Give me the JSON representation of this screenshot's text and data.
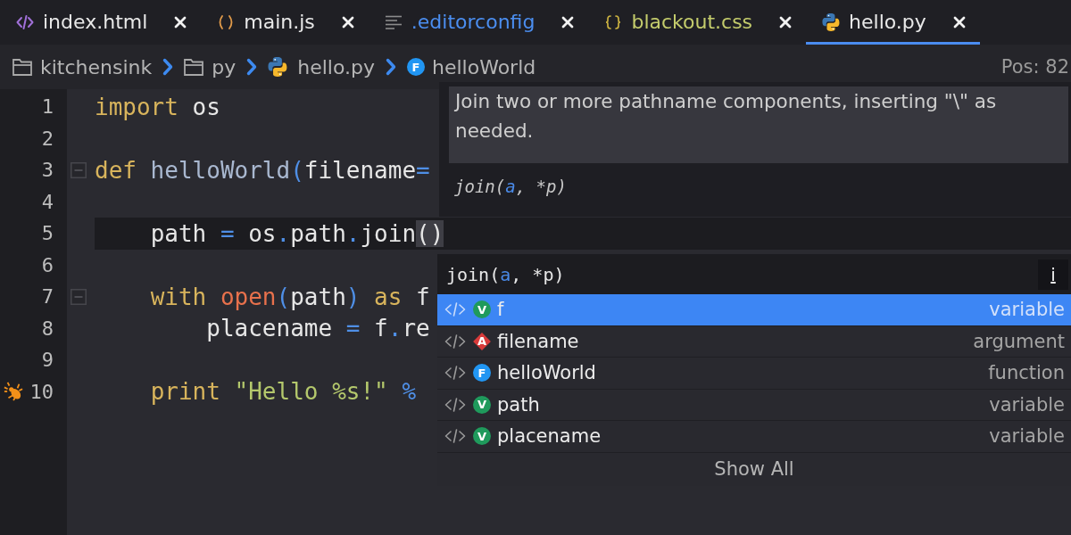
{
  "tabs": [
    {
      "label": "index.html",
      "kind": "html",
      "color": "#e8e8e8",
      "selected": false
    },
    {
      "label": "main.js",
      "kind": "js",
      "color": "#e8e8e8",
      "selected": false
    },
    {
      "label": ".editorconfig",
      "kind": "config",
      "color": "#4b8ef0",
      "selected": false
    },
    {
      "label": "blackout.css",
      "kind": "css",
      "color": "#c4cc6c",
      "selected": false
    },
    {
      "label": "hello.py",
      "kind": "python",
      "color": "#e8e8e8",
      "selected": true
    }
  ],
  "breadcrumb": {
    "items": [
      {
        "label": "kitchensink",
        "kind": "folder"
      },
      {
        "label": "py",
        "kind": "folder"
      },
      {
        "label": "hello.py",
        "kind": "python"
      },
      {
        "label": "helloWorld",
        "kind": "function",
        "badge": "F"
      }
    ],
    "position": "Pos: 82"
  },
  "editor": {
    "lines": [
      {
        "number": "1",
        "current": false,
        "flagged": false,
        "foldable": false,
        "tokens": [
          {
            "text": "import",
            "kind": "keyword"
          },
          {
            "text": " os",
            "kind": "name"
          }
        ]
      },
      {
        "number": "2",
        "current": false,
        "flagged": false,
        "foldable": false
      },
      {
        "number": "3",
        "current": false,
        "flagged": false,
        "foldable": true,
        "tokens": [
          {
            "text": "def",
            "kind": "keyword"
          },
          {
            "text": " helloWorld",
            "kind": "func"
          },
          {
            "text": "(",
            "kind": "paren"
          },
          {
            "text": "filename",
            "kind": "name"
          },
          {
            "text": "=",
            "kind": "op"
          }
        ]
      },
      {
        "number": "4",
        "current": false,
        "flagged": false,
        "foldable": false
      },
      {
        "number": "5",
        "current": true,
        "flagged": false,
        "foldable": false,
        "tokens": [
          {
            "text": "    path ",
            "kind": "name"
          },
          {
            "text": "=",
            "kind": "op"
          },
          {
            "text": " os",
            "kind": "name"
          },
          {
            "text": ".",
            "kind": "op"
          },
          {
            "text": "path",
            "kind": "name"
          },
          {
            "text": ".",
            "kind": "op"
          },
          {
            "text": "join",
            "kind": "name"
          },
          {
            "text": "()",
            "kind": "match"
          }
        ]
      },
      {
        "number": "6",
        "current": false,
        "flagged": false,
        "foldable": false
      },
      {
        "number": "7",
        "current": false,
        "flagged": false,
        "foldable": true,
        "tokens": [
          {
            "text": "    with",
            "kind": "keyword"
          },
          {
            "text": " open",
            "kind": "builtin"
          },
          {
            "text": "(",
            "kind": "paren"
          },
          {
            "text": "path",
            "kind": "name"
          },
          {
            "text": ")",
            "kind": "paren"
          },
          {
            "text": " as",
            "kind": "keyword"
          },
          {
            "text": " f",
            "kind": "name"
          }
        ]
      },
      {
        "number": "8",
        "current": false,
        "flagged": false,
        "foldable": false,
        "tokens": [
          {
            "text": "        placename ",
            "kind": "name"
          },
          {
            "text": "=",
            "kind": "op"
          },
          {
            "text": " f",
            "kind": "name"
          },
          {
            "text": ".",
            "kind": "op"
          },
          {
            "text": "re",
            "kind": "name"
          }
        ]
      },
      {
        "number": "9",
        "current": false,
        "flagged": false,
        "foldable": false
      },
      {
        "number": "10",
        "current": false,
        "flagged": true,
        "foldable": false,
        "tokens": [
          {
            "text": "    print",
            "kind": "keyword"
          },
          {
            "text": " \"Hello %s!\"",
            "kind": "string"
          },
          {
            "text": " %",
            "kind": "op"
          }
        ]
      }
    ]
  },
  "hint": {
    "doc": "Join two or more pathname components, inserting \"\\\" as needed.",
    "signature": [
      {
        "text": "join(",
        "kind": "plain"
      },
      {
        "text": "a",
        "kind": "param"
      },
      {
        "text": ", *p)",
        "kind": "plain"
      }
    ]
  },
  "completion": {
    "signature": [
      {
        "text": "join(",
        "kind": "plain"
      },
      {
        "text": "a",
        "kind": "param"
      },
      {
        "text": ", *p)",
        "kind": "plain"
      }
    ],
    "info": "i",
    "items": [
      {
        "name": "f",
        "type": "variable",
        "kind": "variable",
        "badge": "V",
        "selected": true
      },
      {
        "name": "filename",
        "type": "argument",
        "kind": "argument",
        "badge": "A",
        "selected": false
      },
      {
        "name": "helloWorld",
        "type": "function",
        "kind": "function",
        "badge": "F",
        "selected": false
      },
      {
        "name": "path",
        "type": "variable",
        "kind": "variable",
        "badge": "V",
        "selected": false
      },
      {
        "name": "placename",
        "type": "variable",
        "kind": "variable",
        "badge": "V",
        "selected": false
      }
    ],
    "show_all": "Show All"
  }
}
